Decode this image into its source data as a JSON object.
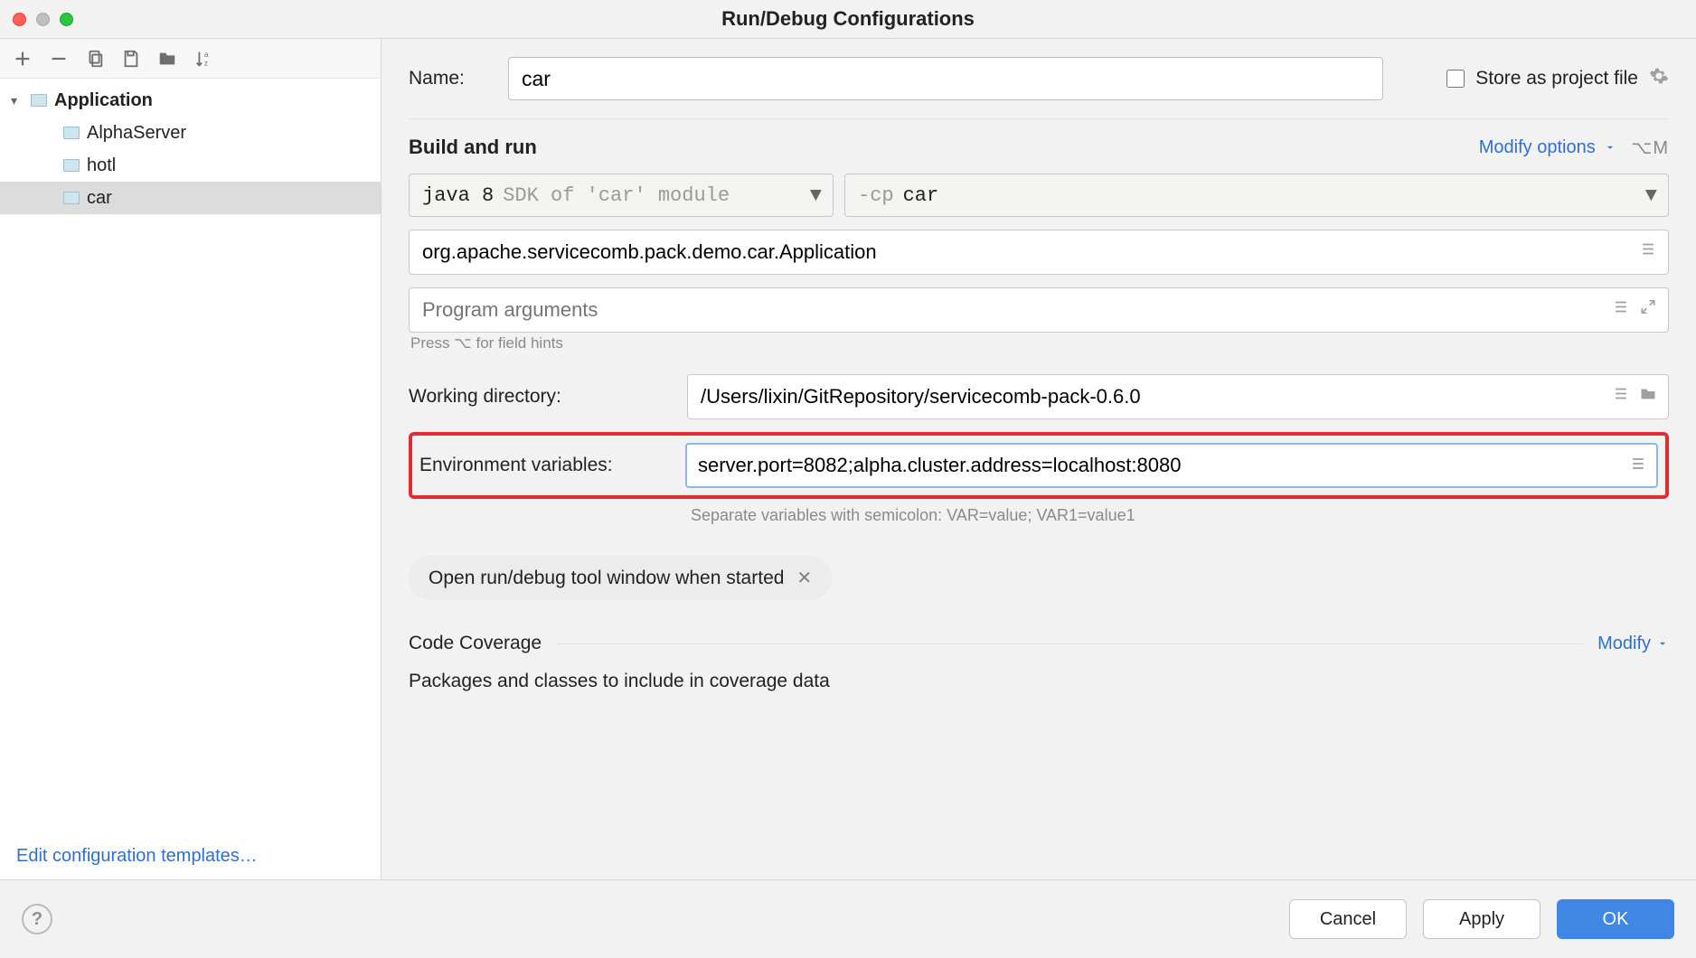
{
  "window": {
    "title": "Run/Debug Configurations"
  },
  "sidebar": {
    "root_label": "Application",
    "items": [
      {
        "label": "AlphaServer"
      },
      {
        "label": "hotl"
      },
      {
        "label": "car"
      }
    ],
    "edit_templates": "Edit configuration templates…"
  },
  "form": {
    "name_label": "Name:",
    "name_value": "car",
    "store_as_project": "Store as project file",
    "build_run_title": "Build and run",
    "modify_options": "Modify options",
    "modify_options_shortcut": "⌥M",
    "sdk_primary": "java 8",
    "sdk_secondary": "SDK of 'car' module",
    "cp_prefix": "-cp",
    "cp_value": "car",
    "main_class": "org.apache.servicecomb.pack.demo.car.Application",
    "program_args_placeholder": "Program arguments",
    "field_hint": "Press ⌥ for field hints",
    "working_dir_label": "Working directory:",
    "working_dir_value": "/Users/lixin/GitRepository/servicecomb-pack-0.6.0",
    "env_label": "Environment variables:",
    "env_value": "server.port=8082;alpha.cluster.address=localhost:8080",
    "env_hint": "Separate variables with semicolon: VAR=value; VAR1=value1",
    "chip_text": "Open run/debug tool window when started",
    "code_coverage_title": "Code Coverage",
    "code_coverage_modify": "Modify",
    "packages_text": "Packages and classes to include in coverage data"
  },
  "footer": {
    "cancel": "Cancel",
    "apply": "Apply",
    "ok": "OK"
  }
}
